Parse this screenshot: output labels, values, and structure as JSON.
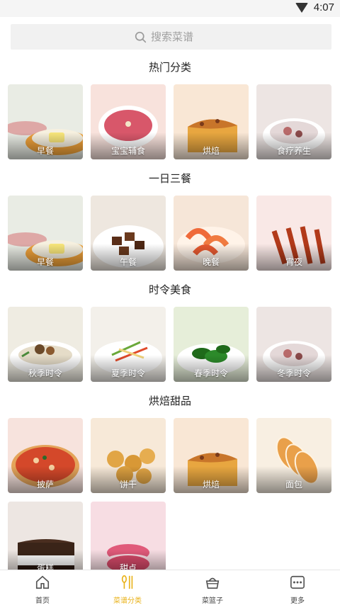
{
  "status": {
    "time": "4:07"
  },
  "search": {
    "placeholder": "搜索菜谱"
  },
  "sections": [
    {
      "title": "热门分类",
      "items": [
        {
          "label": "早餐",
          "art": "breakfast"
        },
        {
          "label": "宝宝辅食",
          "art": "soup"
        },
        {
          "label": "烘焙",
          "art": "cake"
        },
        {
          "label": "食疗养生",
          "art": "stew"
        }
      ]
    },
    {
      "title": "一日三餐",
      "items": [
        {
          "label": "早餐",
          "art": "breakfast"
        },
        {
          "label": "午餐",
          "art": "meat"
        },
        {
          "label": "晚餐",
          "art": "shrimp"
        },
        {
          "label": "宵夜",
          "art": "skewer"
        }
      ]
    },
    {
      "title": "时令美食",
      "items": [
        {
          "label": "秋季时令",
          "art": "mushroom"
        },
        {
          "label": "夏季时令",
          "art": "salad"
        },
        {
          "label": "春季时令",
          "art": "greens"
        },
        {
          "label": "冬季时令",
          "art": "stew"
        }
      ]
    },
    {
      "title": "烘焙甜品",
      "items": [
        {
          "label": "披萨",
          "art": "pizza"
        },
        {
          "label": "饼干",
          "art": "cookie"
        },
        {
          "label": "烘焙",
          "art": "cake"
        },
        {
          "label": "面包",
          "art": "bread"
        },
        {
          "label": "蛋糕",
          "art": "layercake"
        },
        {
          "label": "甜点",
          "art": "macaron"
        }
      ]
    }
  ],
  "tabs": [
    {
      "label": "首页",
      "icon": "home-icon"
    },
    {
      "label": "菜谱分类",
      "icon": "utensils-icon",
      "active": true
    },
    {
      "label": "菜篮子",
      "icon": "basket-icon"
    },
    {
      "label": "更多",
      "icon": "more-icon"
    }
  ],
  "colors": {
    "accent": "#e9b21a",
    "searchBg": "#f1f1f1"
  }
}
